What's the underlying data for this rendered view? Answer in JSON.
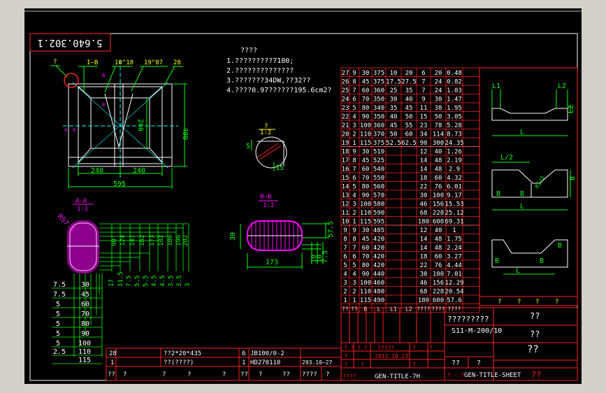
{
  "drawing_number": "5.640.302.1",
  "notes": [
    "????",
    "1.?????????7100;",
    "2.??????????????",
    "3.???????34DW,??32??",
    "4.????0.97??????195.6cm2?"
  ],
  "top_labels": {
    "lead": "?",
    "ib": "I—B",
    "l1": "10\"18",
    "l2": "19\"87",
    "l3": "28"
  },
  "plan_dims": {
    "left": "240",
    "right": "240",
    "total": "595",
    "height": "490",
    "mid": "260"
  },
  "section_marks": {
    "b1": "B",
    "b2": "B",
    "a1": "A",
    "a2": "A"
  },
  "detail_a": {
    "label": "A—A",
    "scale": "1:1",
    "radius": "R57.5"
  },
  "detail_q": {
    "label": "?",
    "scale": "1:2",
    "d1": "5",
    "d2": "15"
  },
  "detail_b": {
    "label": "B—B",
    "scale": "1:1",
    "width": "173",
    "h1": "30",
    "v1": "57.5",
    "v2": "10",
    "v3": "10",
    "v4": "7.5"
  },
  "stack_dims": [
    "17",
    "11.5",
    "7.5",
    "5.5",
    "5.5",
    "4.5",
    "4.5",
    "3.5",
    "3.5",
    "3"
  ],
  "right_dims": [
    "90",
    "124",
    "147",
    "162",
    "173",
    "182",
    "186",
    "196",
    "202"
  ],
  "left_rows": [
    {
      "a": "7.5",
      "b": "30"
    },
    {
      "a": "7.5",
      "b": "45"
    },
    {
      "a": "5",
      "b": "60"
    },
    {
      "a": "5",
      "b": "70"
    },
    {
      "a": "5",
      "b": "80"
    },
    {
      "a": "5",
      "b": "90"
    },
    {
      "a": "5",
      "b": "100"
    },
    {
      "a": "2.5",
      "b": "110"
    },
    {
      "a": "",
      "b": "115"
    }
  ],
  "table_header": [
    "??",
    "??",
    "B",
    "L",
    "L1",
    "L2",
    "????",
    "????",
    "????"
  ],
  "table_rows": [
    [
      "27",
      "9",
      "30",
      "375",
      "10",
      "20",
      "6",
      "20",
      "0.48"
    ],
    [
      "26",
      "8",
      "45",
      "375",
      "17.5",
      "27.5",
      "7",
      "24",
      "0.82"
    ],
    [
      "25",
      "7",
      "60",
      "360",
      "25",
      "35",
      "7",
      "24",
      "1.03"
    ],
    [
      "24",
      "6",
      "70",
      "350",
      "30",
      "40",
      "9",
      "30",
      "1.47"
    ],
    [
      "23",
      "5",
      "80",
      "340",
      "35",
      "45",
      "11",
      "38",
      "1.95"
    ],
    [
      "22",
      "4",
      "90",
      "350",
      "40",
      "50",
      "15",
      "50",
      "3.05"
    ],
    [
      "21",
      "3",
      "100",
      "360",
      "45",
      "55",
      "23",
      "78",
      "5.28"
    ],
    [
      "20",
      "2",
      "110",
      "370",
      "50",
      "60",
      "34",
      "114",
      "8.73"
    ],
    [
      "19",
      "1",
      "115",
      "375",
      "52.5",
      "62.5",
      "90",
      "300",
      "24.35"
    ],
    [
      "18",
      "9",
      "30",
      "510",
      "",
      "",
      "12",
      "40",
      "1.26"
    ],
    [
      "17",
      "8",
      "45",
      "525",
      "",
      "",
      "14",
      "48",
      "2.19"
    ],
    [
      "16",
      "7",
      "60",
      "540",
      "",
      "",
      "14",
      "48",
      "2.9"
    ],
    [
      "15",
      "6",
      "70",
      "550",
      "",
      "",
      "18",
      "60",
      "4.32"
    ],
    [
      "14",
      "5",
      "80",
      "560",
      "",
      "",
      "22",
      "76",
      "6.01"
    ],
    [
      "13",
      "4",
      "90",
      "570",
      "",
      "",
      "30",
      "100",
      "9.17"
    ],
    [
      "12",
      "3",
      "100",
      "580",
      "",
      "",
      "46",
      "156",
      "15.53"
    ],
    [
      "11",
      "2",
      "110",
      "590",
      "",
      "",
      "68",
      "228",
      "25.12"
    ],
    [
      "10",
      "1",
      "115",
      "595",
      "",
      "",
      "180",
      "600",
      "69.31"
    ],
    [
      "9",
      "9",
      "30",
      "405",
      "",
      "",
      "12",
      "40",
      "1"
    ],
    [
      "8",
      "8",
      "45",
      "420",
      "",
      "",
      "14",
      "48",
      "1.75"
    ],
    [
      "7",
      "7",
      "60",
      "420",
      "",
      "",
      "14",
      "48",
      "2.24"
    ],
    [
      "6",
      "6",
      "70",
      "420",
      "",
      "",
      "18",
      "60",
      "3.27"
    ],
    [
      "5",
      "5",
      "80",
      "420",
      "",
      "",
      "22",
      "76",
      "4.44"
    ],
    [
      "4",
      "4",
      "90",
      "440",
      "",
      "",
      "30",
      "100",
      "7.01"
    ],
    [
      "3",
      "3",
      "100",
      "460",
      "",
      "",
      "46",
      "156",
      "12.29"
    ],
    [
      "2",
      "2",
      "110",
      "480",
      "",
      "",
      "68",
      "228",
      "20.54"
    ],
    [
      "1",
      "1",
      "115",
      "490",
      "",
      "",
      "180",
      "600",
      "57.6"
    ]
  ],
  "sketch_labels": {
    "l1": "L1",
    "l2": "L2",
    "l2v": "L2",
    "l": "L",
    "lh": "L/2",
    "r": "R1/2",
    "b": "B"
  },
  "sketch_header": [
    "?",
    "?",
    "?",
    "?"
  ],
  "bom_rows": [
    {
      "no": "28",
      "name": "??2*20*435",
      "qty": "6",
      "mat": "JB100/0-2",
      "note": ""
    },
    {
      "no": "1",
      "name": "??(????)",
      "qty": "1",
      "mat": "HD270110",
      "note": "293.10—27"
    }
  ],
  "bom_footer": [
    "??",
    "?",
    "?",
    "?",
    "?",
    "??",
    "?",
    "??",
    "????",
    "?"
  ],
  "title_block": {
    "title": "?????????",
    "code": "S11-M-200/10",
    "q1": "??",
    "q2": "??",
    "q3": "??",
    "sig_row": "? ? ? ?",
    "date": "2013.10.23",
    "sig_mid": "?????",
    "sig_cells": [
      "?",
      "?",
      "?",
      "?",
      "?",
      "?"
    ],
    "sub1": "??",
    "sub2": "?",
    "gen_left": "GEN-TITLE-7H",
    "gen_right": "GEN-TITLE-SHEET",
    "gen_prefix": "? - ?",
    "bottom_left": "????",
    "red_q": "??"
  }
}
